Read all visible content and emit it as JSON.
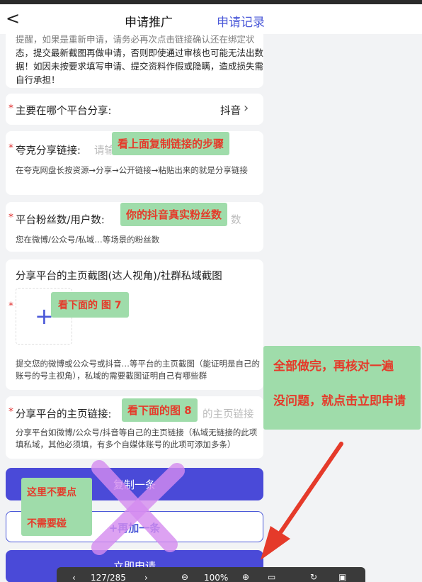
{
  "nav": {
    "back_icon": "chevron-left-icon",
    "title": "申请推广",
    "records": "申请记录"
  },
  "warning": {
    "lines": [
      "提醒，如果是重新申请，请务必再次点击链接确认还在绑定状",
      "态，提交最新截图再做申请，否则即使通过审核也可能无法出数",
      "据！如因未按要求填写申请、提交资料作假或隐瞒，造成损失需",
      "自行承担！"
    ]
  },
  "platform": {
    "required": "*",
    "label": "主要在哪个平台分享:",
    "value": "抖音",
    "chevron_icon": "chevron-right-icon"
  },
  "share_link": {
    "required": "*",
    "label": "夸克分享链接:",
    "placeholder": "请输",
    "hint": "在夸克网盘长按资源→分享→公开链接→粘贴出来的就是分享链接"
  },
  "fans": {
    "required": "*",
    "label": "平台粉丝数/用户数:",
    "placeholder_tail": "数",
    "hint": "您在微博/公众号/私域…等场景的粉丝数"
  },
  "screenshot": {
    "label": "分享平台的主页截图(达人视角)/社群私域截图",
    "required": "*",
    "plus_icon": "plus-icon",
    "hint": "提交您的微博或公众号或抖音…等平台的主页截图（能证明是自己的账号的号主视角），私域的需要截图证明自己有哪些群"
  },
  "homepage_link": {
    "required": "*",
    "label": "分享平台的主页链接:",
    "placeholder_tail": "的主页链接",
    "hint": "分享平台如微博/公众号/抖音等自己的主页链接（私域无链接的此项填私域，其他必须填，有多个自媒体账号的此项可添加多条）"
  },
  "buttons": {
    "copy": "复制一条",
    "add": "+再加一条",
    "submit": "立即申请"
  },
  "annotations": {
    "copy_steps": "看上面复制链接的步骤",
    "real_fans": "你的抖音真实粉丝数",
    "see_fig7": "看下面的 图 7",
    "see_fig8": "看下面的图 8",
    "all_done_1": "全部做完，再核对一遍",
    "all_done_2": "没问题，就点击立即申请",
    "dont_click": "这里不要点",
    "dont_touch": "不需要碰"
  },
  "colors": {
    "accent": "#4a4ad8",
    "required": "#e03030",
    "annotation_bg": "#9fdcaa",
    "annotation_text": "#e53a2a",
    "cross": "#d58cf0",
    "arrow": "#e53a2a"
  },
  "viewer_bar": {
    "prev_icon": "chevron-left-icon",
    "next_icon": "chevron-right-icon",
    "page": "127/285",
    "zoom_out_icon": "zoom-out-icon",
    "zoom": "100%",
    "zoom_in_icon": "zoom-in-icon",
    "fit_icon": "fit-page-icon",
    "rotate_icon": "rotate-icon",
    "more_icon": "layout-icon"
  }
}
